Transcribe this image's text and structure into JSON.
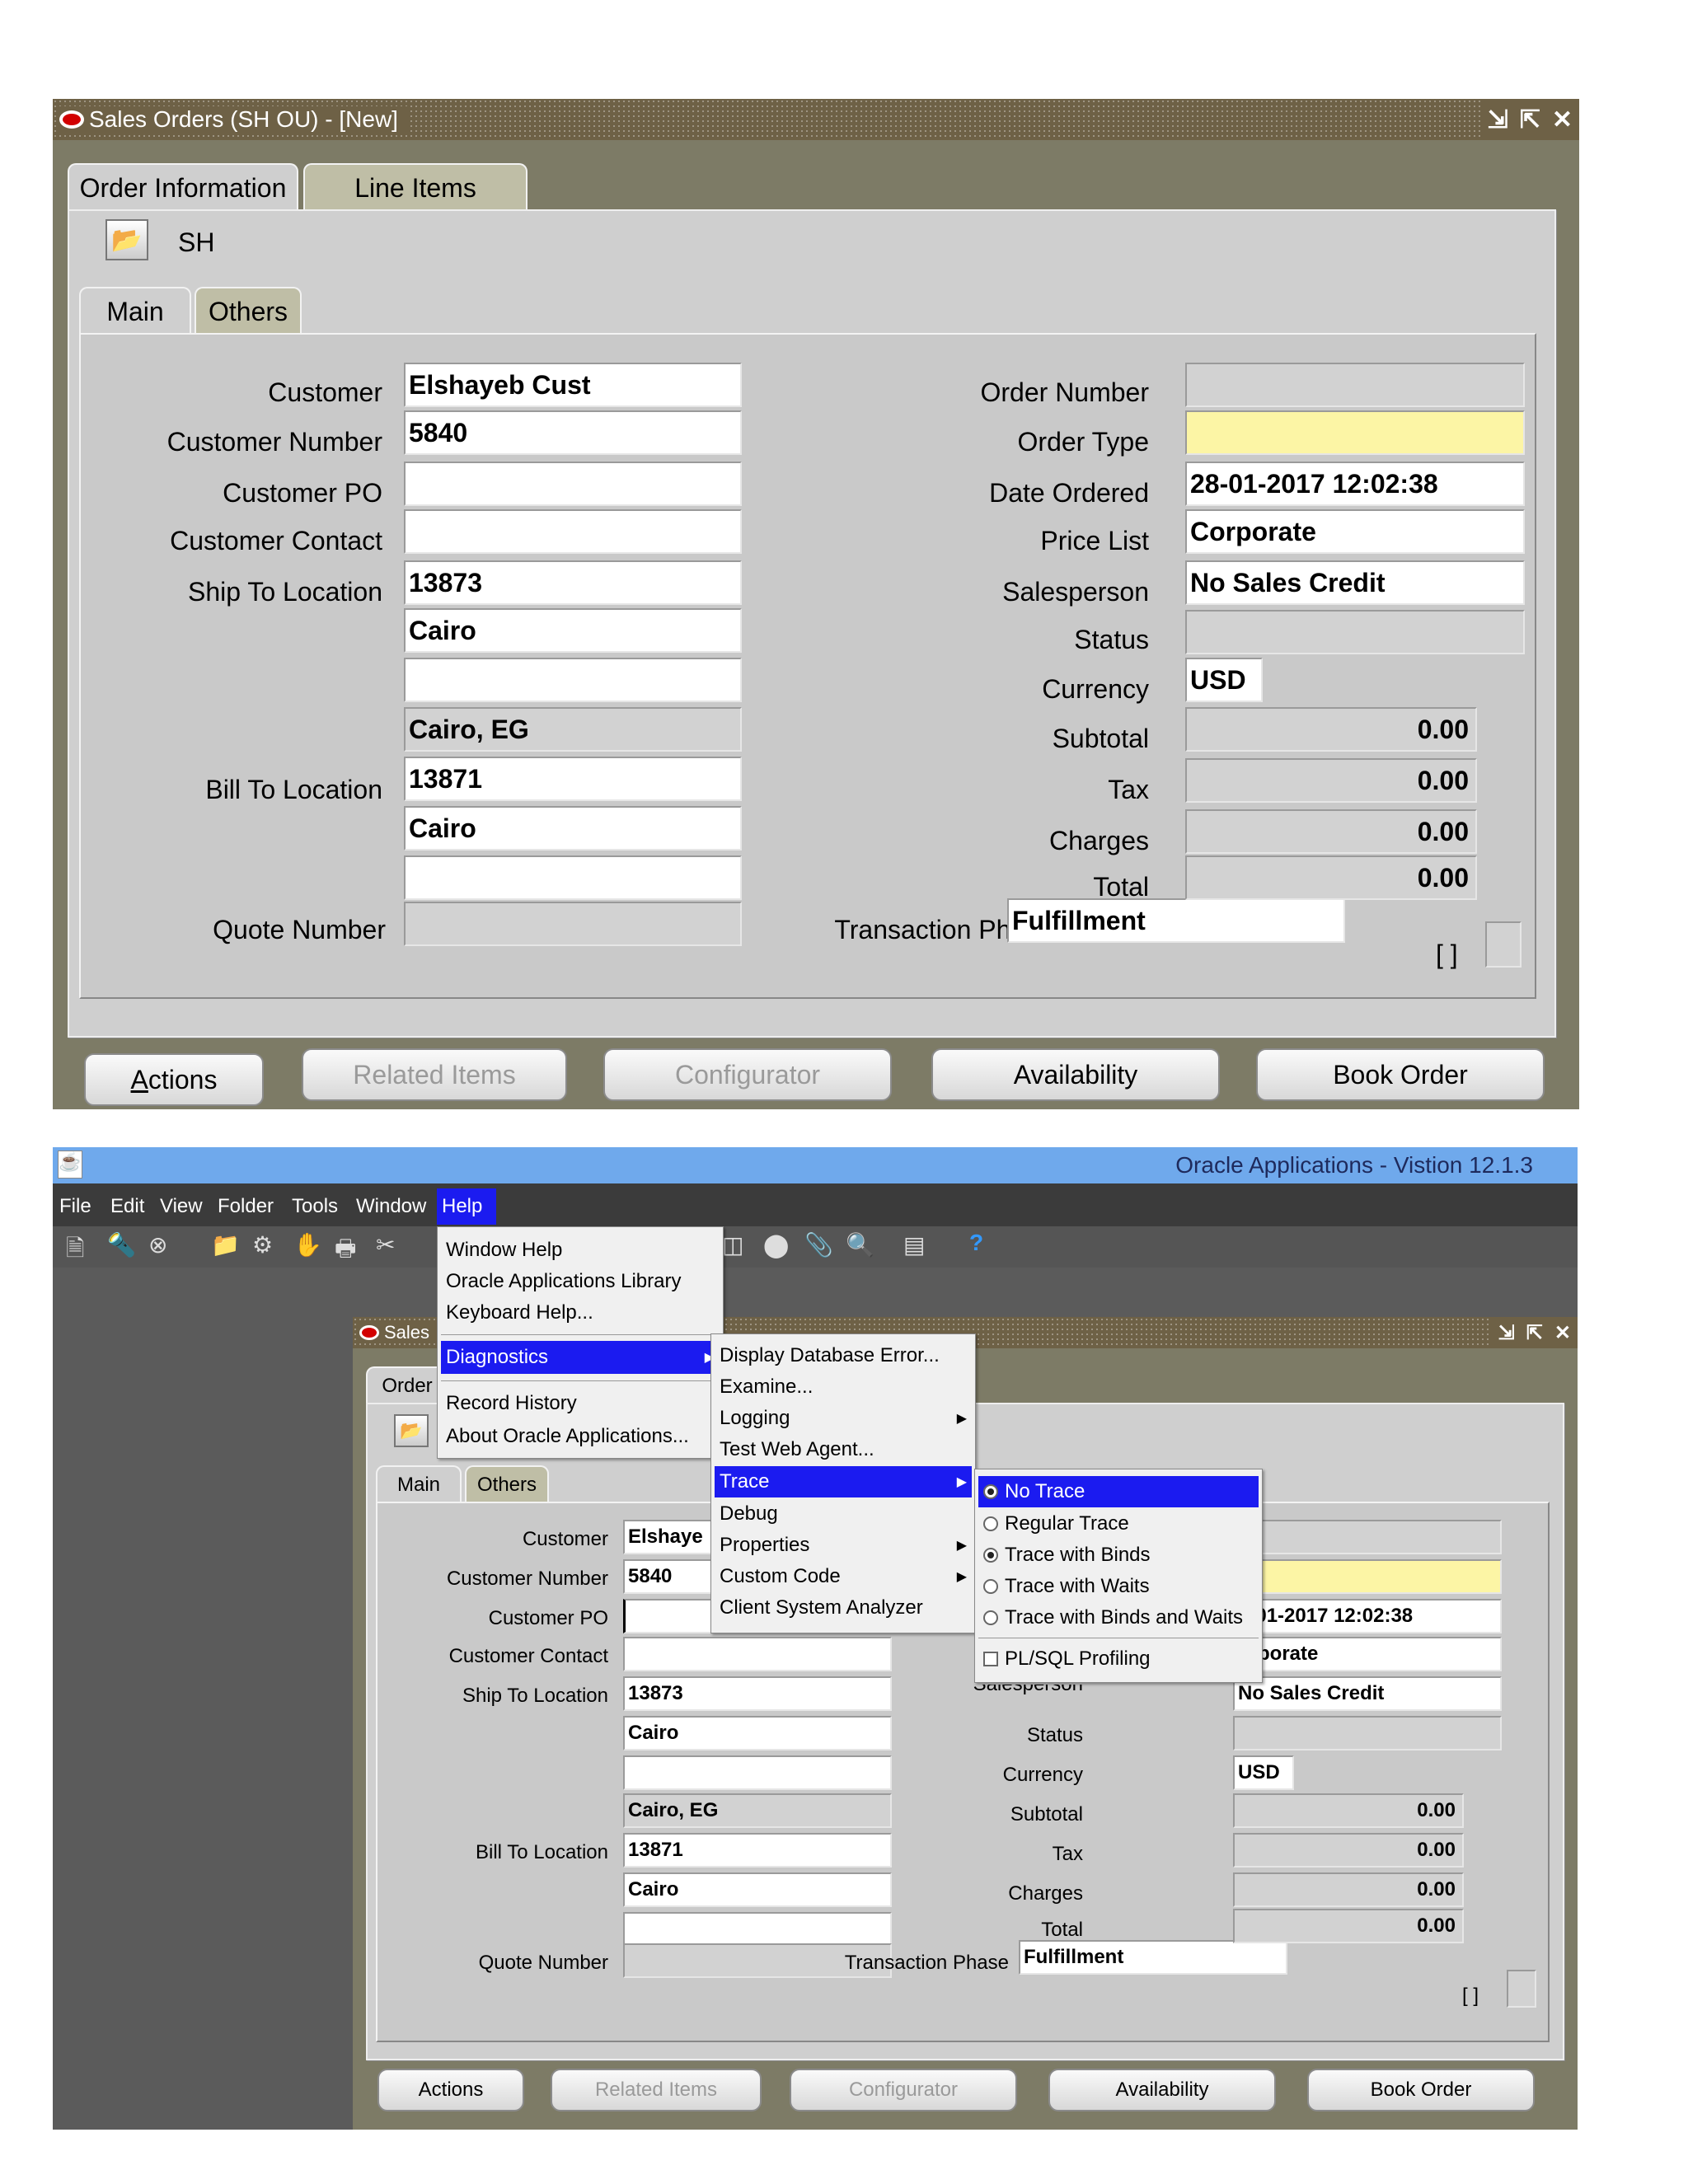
{
  "form": {
    "title": "Sales Orders (SH OU) - [New]",
    "tabs": [
      "Order Information",
      "Line Items"
    ],
    "org_code": "SH",
    "sub_tabs": [
      "Main",
      "Others"
    ],
    "left_labels": {
      "customer": "Customer",
      "customer_number": "Customer Number",
      "customer_po": "Customer PO",
      "customer_contact": "Customer Contact",
      "ship_to": "Ship To Location",
      "bill_to": "Bill To Location",
      "quote_number": "Quote Number"
    },
    "left_values": {
      "customer": "Elshayeb Cust",
      "customer_short": "Elshaye",
      "customer_number": "5840",
      "customer_po": "",
      "customer_contact": "",
      "ship_to": "13873",
      "ship_city": "Cairo",
      "ship_line3": "",
      "ship_country": "Cairo, EG",
      "bill_to": "13871",
      "bill_city": "Cairo",
      "bill_line3": "",
      "quote_number": ""
    },
    "right_labels": {
      "order_number": "Order Number",
      "order_type": "Order Type",
      "date_ordered": "Date Ordered",
      "price_list": "Price List",
      "salesperson": "Salesperson",
      "status": "Status",
      "currency": "Currency",
      "subtotal": "Subtotal",
      "tax": "Tax",
      "charges": "Charges",
      "total": "Total",
      "transaction_phase": "Transaction Phase"
    },
    "right_values": {
      "order_number": "",
      "order_type": "",
      "date_ordered": "28-01-2017 12:02:38",
      "date_ordered_cut": "8-01-2017 12:02:38",
      "price_list": "Corporate",
      "price_list_cut": "orporate",
      "salesperson": "No Sales Credit",
      "salesperson_cut": "No Sales Credit",
      "status": "",
      "currency": "USD",
      "subtotal": "0.00",
      "tax": "0.00",
      "charges": "0.00",
      "total": "0.00",
      "transaction_phase": "Fulfillment",
      "bracket": "[ ]"
    },
    "buttons": {
      "actions": "Actions",
      "related": "Related Items",
      "configurator": "Configurator",
      "availability": "Availability",
      "book": "Book Order"
    },
    "button_mnemonics": {
      "actions": "A",
      "related": "R",
      "configurator": "g",
      "availability": "i",
      "book": "B"
    }
  },
  "app": {
    "title": "Oracle Applications - Vistion 12.1.3",
    "menubar": [
      "File",
      "Edit",
      "View",
      "Folder",
      "Tools",
      "Window",
      "Help"
    ],
    "menubar_mnemonic": [
      "F",
      "E",
      "V",
      "o",
      "T",
      "W",
      "H"
    ],
    "help_menu": [
      "Window Help",
      "Oracle Applications Library",
      "Keyboard Help...",
      "Diagnostics",
      "Record History",
      "About Oracle Applications..."
    ],
    "diagnostics_menu": [
      "Display Database Error...",
      "Examine...",
      "Logging",
      "Test Web Agent...",
      "Trace",
      "Debug",
      "Properties",
      "Custom Code",
      "Client System Analyzer"
    ],
    "trace_menu": [
      "No Trace",
      "Regular Trace",
      "Trace with Binds",
      "Trace with Waits",
      "Trace with Binds and Waits",
      "PL/SQL Profiling"
    ],
    "form_title_cut": "Sales",
    "tab_cut": "Order",
    "hidden_label": "Salesperson",
    "help_icon": "?"
  },
  "colors": {
    "title_bg": "#6e6146",
    "window_bg": "#7d7b66",
    "panel": "#cfcfcf",
    "required": "#fcf5a5",
    "menu_highlight": "#1b1bf0",
    "app_title_bg": "#6fa9ec",
    "menubar_bg": "#3b3b3b"
  }
}
